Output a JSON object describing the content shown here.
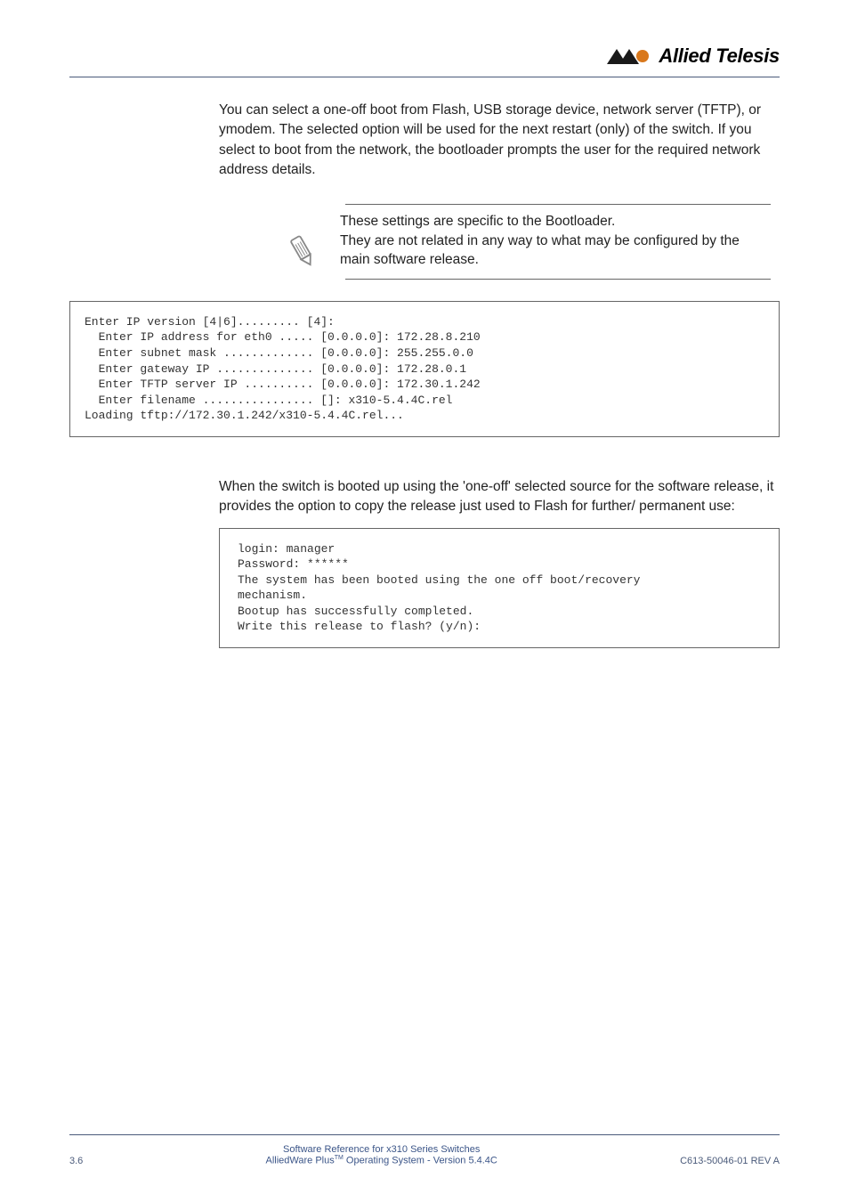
{
  "header": {
    "logo_text": "Allied Telesis"
  },
  "para1": "You can select a one-off boot from Flash, USB storage device, network server (TFTP), or ymodem. The selected option will be used for the next restart (only) of the switch. If you select to boot from the network, the bootloader prompts the user for the required network address details.",
  "note": {
    "line1": "These settings are specific to the Bootloader.",
    "line2": "They are not related in any way to what may be configured by the main software release."
  },
  "code1": "Enter IP version [4|6]......... [4]:\n  Enter IP address for eth0 ..... [0.0.0.0]: 172.28.8.210\n  Enter subnet mask ............. [0.0.0.0]: 255.255.0.0\n  Enter gateway IP .............. [0.0.0.0]: 172.28.0.1\n  Enter TFTP server IP .......... [0.0.0.0]: 172.30.1.242\n  Enter filename ................ []: x310-5.4.4C.rel\nLoading tftp://172.30.1.242/x310-5.4.4C.rel...",
  "para2": "When the switch is booted up using the 'one-off' selected source for the software release, it provides the option to copy the release just used to Flash for further/ permanent use:",
  "code2": "login: manager\nPassword: ******\nThe system has been booted using the one off boot/recovery\nmechanism.\nBootup has successfully completed.\nWrite this release to flash? (y/n):",
  "footer": {
    "page": "3.6",
    "title1": "Software Reference for x310 Series Switches",
    "title2_a": "AlliedWare Plus",
    "title2_b": " Operating System  - Version 5.4.4C",
    "rev": "C613-50046-01 REV A"
  }
}
